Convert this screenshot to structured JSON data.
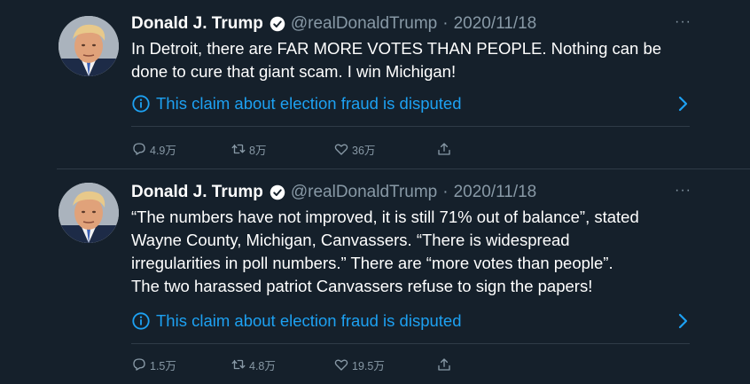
{
  "colors": {
    "background": "#15202b",
    "text": "#ffffff",
    "muted": "#8899a6",
    "link": "#1da1f2",
    "divider": "#2f3b47"
  },
  "tweets": [
    {
      "author": {
        "name": "Donald J. Trump",
        "handle": "@realDonaldTrump",
        "verified": true
      },
      "separator": "·",
      "date": "2020/11/18",
      "more_icon": "more-icon",
      "text_lines": [
        "In Detroit, there are FAR MORE VOTES THAN PEOPLE. Nothing can be",
        "done to cure that giant scam. I win Michigan!"
      ],
      "notice": {
        "icon": "info-icon",
        "label": "This claim about election fraud is disputed"
      },
      "actions": {
        "replies": "4.9万",
        "retweets": "8万",
        "likes": "36万",
        "share_icon": "share-icon"
      }
    },
    {
      "author": {
        "name": "Donald J. Trump",
        "handle": "@realDonaldTrump",
        "verified": true
      },
      "separator": "·",
      "date": "2020/11/18",
      "more_icon": "more-icon",
      "text_lines": [
        "“The numbers have not improved, it is still 71% out of balance”, stated",
        "Wayne County, Michigan,  Canvassers. “There is widespread",
        "irregularities in poll numbers.” There are “more votes than people”.",
        "The two harassed patriot Canvassers refuse to sign the papers!"
      ],
      "notice": {
        "icon": "info-icon",
        "label": "This claim about election fraud is disputed"
      },
      "actions": {
        "replies": "1.5万",
        "retweets": "4.8万",
        "likes": "19.5万",
        "share_icon": "share-icon"
      }
    }
  ]
}
